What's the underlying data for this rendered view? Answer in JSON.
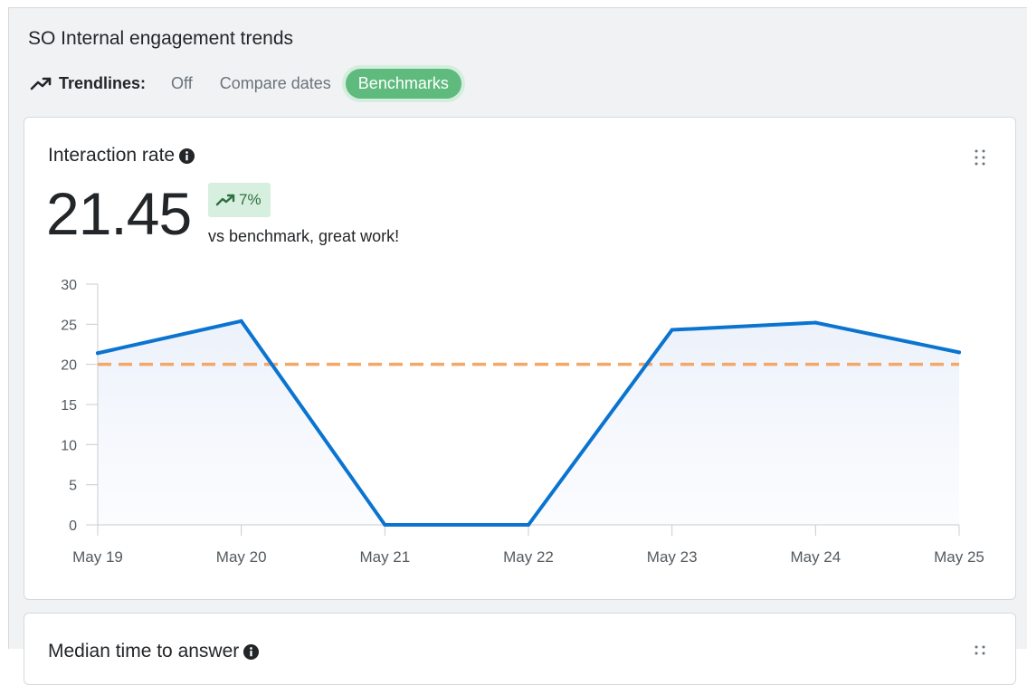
{
  "panel": {
    "title": "SO Internal engagement trends",
    "trendlines_label": "Trendlines:",
    "options": [
      "Off",
      "Compare dates",
      "Benchmarks"
    ],
    "active_option": "Benchmarks"
  },
  "card": {
    "title": "Interaction rate",
    "value": "21.45",
    "delta": "7%",
    "delta_note": "vs benchmark, great work!"
  },
  "card2": {
    "title": "Median time to answer"
  },
  "colors": {
    "accent_green": "#5eba7d",
    "line_blue": "#0a74d0",
    "benchmark_orange": "#f4a867"
  },
  "chart_data": {
    "type": "line",
    "categories": [
      "May 19",
      "May 20",
      "May 21",
      "May 22",
      "May 23",
      "May 24",
      "May 25"
    ],
    "series": [
      {
        "values": [
          21.4,
          25.4,
          0,
          0,
          24.3,
          25.2,
          21.5
        ]
      }
    ],
    "benchmark": 20,
    "ylim": [
      0,
      30
    ],
    "yticks": [
      0,
      5,
      10,
      15,
      20,
      25,
      30
    ],
    "grid": false,
    "area_fill": true
  }
}
